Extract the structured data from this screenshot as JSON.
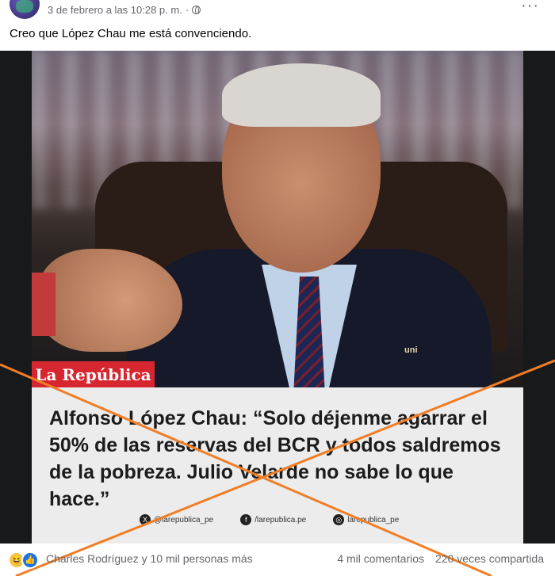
{
  "post": {
    "timestamp": "3 de febrero a las 10:28 p. m.",
    "separator": "·",
    "more_label": "···",
    "caption": "Creo que López Chau me está convenciendo."
  },
  "image": {
    "brand": "La República",
    "pin_text": "uni",
    "quote_name": "Alfonso López Chau:",
    "quote_text": "“Solo déjenme agarrar el 50% de las reservas del BCR y todos saldremos de la pobreza. Julio Velarde no sabe lo que hace.”",
    "socials": [
      {
        "icon": "x-icon",
        "glyph": "X",
        "label": "@larepublica_pe"
      },
      {
        "icon": "facebook-icon",
        "glyph": "f",
        "label": "/larepublica.pe"
      },
      {
        "icon": "instagram-icon",
        "glyph": "◎",
        "label": "larepublica_pe"
      }
    ],
    "cross_color": "#f07e26"
  },
  "footer": {
    "reactions_text": "Charles Rodríguez y 10 mil personas más",
    "comments": "4 mil comentarios",
    "shares": "220 veces compartida"
  }
}
